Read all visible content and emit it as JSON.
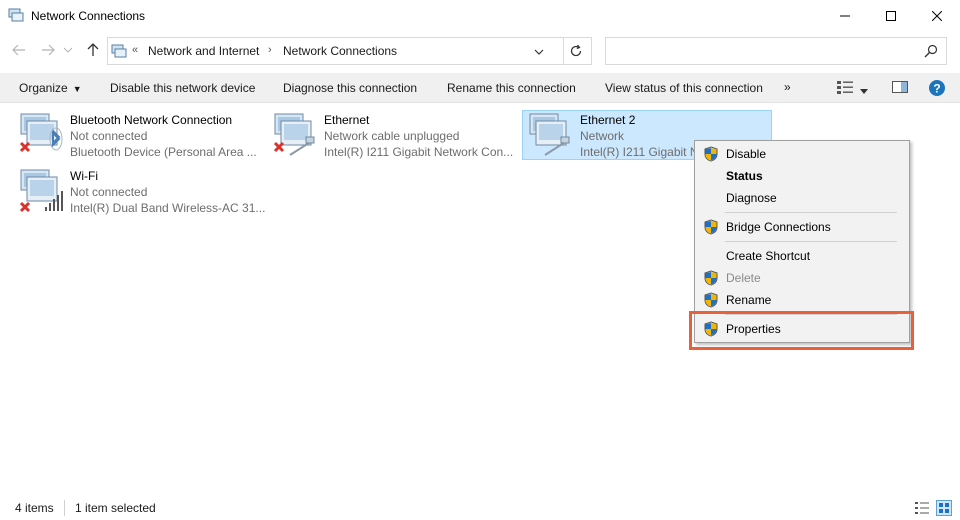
{
  "window": {
    "title": "Network Connections"
  },
  "address": {
    "prefix": "«",
    "crumbs": [
      "Network and Internet",
      "Network Connections"
    ],
    "separator": "›"
  },
  "search": {
    "placeholder": ""
  },
  "toolbar": {
    "organize": "Organize",
    "disable": "Disable this network device",
    "diagnose": "Diagnose this connection",
    "rename": "Rename this connection",
    "view_status": "View status of this connection",
    "more": "»"
  },
  "items": [
    {
      "name": "Bluetooth Network Connection",
      "status": "Not connected",
      "device": "Bluetooth Device (Personal Area ..."
    },
    {
      "name": "Ethernet",
      "status": "Network cable unplugged",
      "device": "Intel(R) I211 Gigabit Network Con..."
    },
    {
      "name": "Ethernet 2",
      "status": "Network",
      "device": "Intel(R) I211 Gigabit Network Con..."
    },
    {
      "name": "Wi-Fi",
      "status": "Not connected",
      "device": "Intel(R) Dual Band Wireless-AC 31..."
    }
  ],
  "context_menu": {
    "items": [
      {
        "label": "Disable",
        "shield": true
      },
      {
        "label": "Status",
        "bold": true
      },
      {
        "label": "Diagnose"
      },
      {
        "label": "Bridge Connections",
        "shield": true
      },
      {
        "label": "Create Shortcut"
      },
      {
        "label": "Delete",
        "shield": true,
        "disabled": true
      },
      {
        "label": "Rename",
        "shield": true
      },
      {
        "label": "Properties",
        "shield": true,
        "highlighted": true
      }
    ]
  },
  "statusbar": {
    "count": "4 items",
    "selected": "1 item selected"
  },
  "colors": {
    "selection_bg": "#cce8ff",
    "selection_border": "#99d1ff",
    "highlight": "#e8603c",
    "help_blue": "#1c75bc"
  }
}
